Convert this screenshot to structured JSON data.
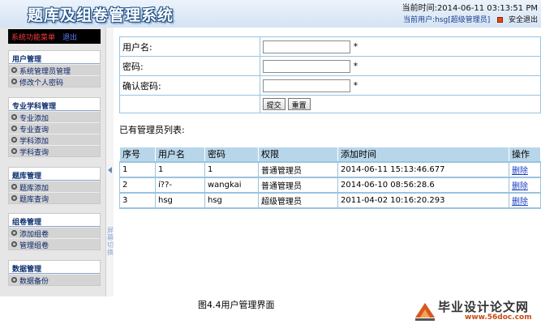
{
  "header": {
    "app_title": "题库及组卷管理系统",
    "datetime": "当前时间:2014-06-11 03:13:51 PM",
    "user_label": "当前用户:hsg[超级管理员]",
    "logout": "安全退出"
  },
  "sidebar": {
    "menu_label": "系统功能菜单",
    "exit_label": "退出",
    "switch_label": "屏幕切换",
    "groups": [
      {
        "title": "用户管理",
        "items": [
          "系统管理员管理",
          "修改个人密码"
        ]
      },
      {
        "title": "专业学科管理",
        "items": [
          "专业添加",
          "专业查询",
          "学科添加",
          "学科查询"
        ]
      },
      {
        "title": "题库管理",
        "items": [
          "题库添加",
          "题库查询"
        ]
      },
      {
        "title": "组卷管理",
        "items": [
          "添加组卷",
          "管理组卷"
        ]
      },
      {
        "title": "数据管理",
        "items": [
          "数据备份"
        ]
      }
    ]
  },
  "form": {
    "username_label": "用户名:",
    "password_label": "密码:",
    "confirm_label": "确认密码:",
    "required_mark": "*",
    "submit_label": "提交",
    "reset_label": "重置"
  },
  "list": {
    "title": "已有管理员列表:",
    "columns": [
      "序号",
      "用户名",
      "密码",
      "权限",
      "添加时间",
      "操作"
    ],
    "rows": [
      [
        "1",
        "1",
        "1",
        "普通管理员",
        "2014-06-11 15:13:46.677",
        "删除"
      ],
      [
        "2",
        "í??-",
        "wangkai",
        "普通管理员",
        "2014-06-10 08:56:28.6",
        "删除"
      ],
      [
        "3",
        "hsg",
        "hsg",
        "超级管理员",
        "2011-04-02 10:16:20.293",
        "删除"
      ]
    ]
  },
  "caption": "图4.4用户管理界面",
  "watermark": {
    "cn": "毕业设计论文网",
    "url": "www.56doc.com"
  },
  "colors": {
    "accent": "#1d4f86",
    "table_header": "#b8d6ea",
    "border": "#9ac3e0",
    "menu_label": "#ff3b3b"
  }
}
